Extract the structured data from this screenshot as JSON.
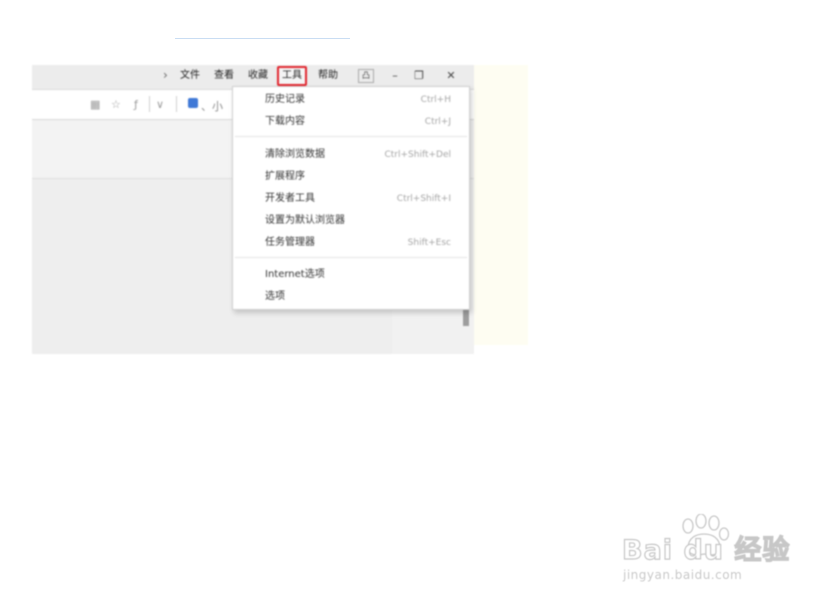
{
  "menubar": {
    "arrow": "›",
    "items": [
      "文件",
      "查看",
      "收藏",
      "工具",
      "帮助"
    ],
    "active_index": 3,
    "window_buttons": [
      "凸",
      "–",
      "❐",
      "✕"
    ]
  },
  "addressbar": {
    "icons": [
      "▦",
      "☆",
      "ƒ",
      "∨"
    ],
    "user_text": "、小"
  },
  "tools_menu": {
    "groups": [
      [
        {
          "label": "历史记录",
          "shortcut": "Ctrl+H"
        },
        {
          "label": "下载内容",
          "shortcut": "Ctrl+J"
        }
      ],
      [
        {
          "label": "清除浏览数据",
          "shortcut": "Ctrl+Shift+Del"
        },
        {
          "label": "扩展程序",
          "shortcut": ""
        },
        {
          "label": "开发者工具",
          "shortcut": "Ctrl+Shift+I"
        },
        {
          "label": "设置为默认浏览器",
          "shortcut": ""
        },
        {
          "label": "任务管理器",
          "shortcut": "Shift+Esc"
        }
      ],
      [
        {
          "label": "Internet选项",
          "shortcut": ""
        },
        {
          "label": "选项",
          "shortcut": ""
        }
      ]
    ]
  },
  "watermark": {
    "brand": "Bai du 经验",
    "url": "jingyan.baidu.com",
    "icon": "paw-icon"
  },
  "colors": {
    "highlight": "#e1232c",
    "side_panel": "#fefdf2",
    "user_icon": "#3f78d6"
  }
}
